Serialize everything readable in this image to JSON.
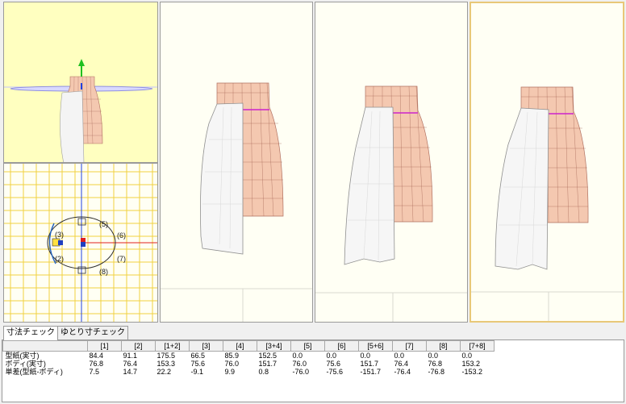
{
  "tabs": [
    {
      "label": "寸法チェック",
      "active": true
    },
    {
      "label": "ゆとり寸チェック",
      "active": false
    }
  ],
  "plan_labels": [
    "(5)",
    "(6)",
    "(7)",
    "(8)",
    "(3)",
    "(2)"
  ],
  "table": {
    "headers": [
      "",
      "[1]",
      "[2]",
      "[1+2]",
      "[3]",
      "[4]",
      "[3+4]",
      "[5]",
      "[6]",
      "[5+6]",
      "[7]",
      "[8]",
      "[7+8]"
    ],
    "rows": [
      {
        "label": "型紙(実寸)",
        "values": [
          "84.4",
          "91.1",
          "175.5",
          "66.5",
          "85.9",
          "152.5",
          "0.0",
          "0.0",
          "0.0",
          "0.0",
          "0.0",
          "0.0"
        ]
      },
      {
        "label": "ボディ(実寸)",
        "values": [
          "76.8",
          "76.4",
          "153.3",
          "75.6",
          "76.0",
          "151.7",
          "76.0",
          "75.6",
          "151.7",
          "76.4",
          "76.8",
          "153.2"
        ]
      },
      {
        "label": "単差(型紙-ボディ)",
        "values": [
          "7.5",
          "14.7",
          "22.2",
          "-9.1",
          "9.9",
          "0.8",
          "-76.0",
          "-75.6",
          "-151.7",
          "-76.4",
          "-76.8",
          "-153.2"
        ]
      }
    ]
  },
  "colors": {
    "skin": "#f4c8b0",
    "skin_shade": "#e0a88e",
    "waist_line": "#cc22cc",
    "top_view_bg": "#ffffc0",
    "grid": "#f0d040",
    "axis_red": "#e02020",
    "axis_blue": "#2040e0",
    "axis_green": "#20c020"
  }
}
